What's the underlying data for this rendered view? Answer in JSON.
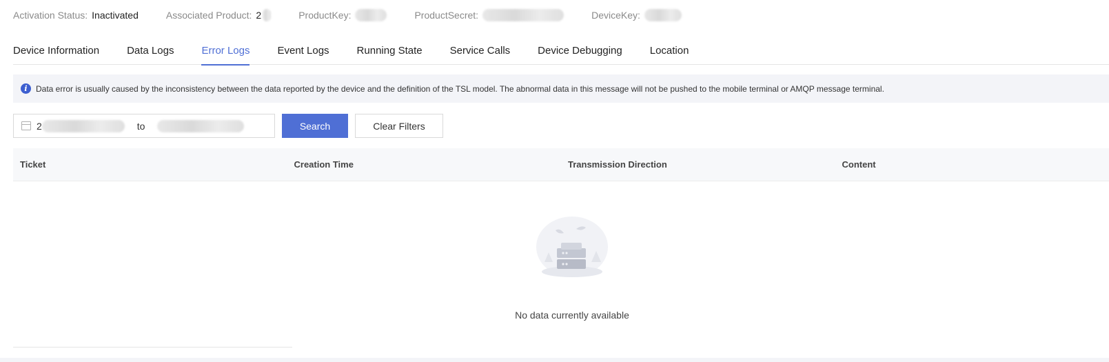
{
  "info": {
    "activation_label": "Activation Status:",
    "activation_value": "Inactivated",
    "product_label": "Associated Product:",
    "product_value": "2",
    "productkey_label": "ProductKey:",
    "productsecret_label": "ProductSecret:",
    "devicekey_label": "DeviceKey:"
  },
  "tabs": [
    {
      "label": "Device Information"
    },
    {
      "label": "Data Logs"
    },
    {
      "label": "Error Logs",
      "active": true
    },
    {
      "label": "Event Logs"
    },
    {
      "label": "Running State"
    },
    {
      "label": "Service Calls"
    },
    {
      "label": "Device Debugging"
    },
    {
      "label": "Location"
    }
  ],
  "notice": {
    "icon": "info-icon",
    "text": "Data error is usually caused by the inconsistency between the data reported by the device and the definition of the TSL model. The abnormal data in this message will not be pushed to the mobile terminal or AMQP message terminal."
  },
  "filters": {
    "date_icon": "calendar-icon",
    "date_start_prefix": "2",
    "separator": "to",
    "search_label": "Search",
    "clear_label": "Clear Filters"
  },
  "table": {
    "columns": [
      "Ticket",
      "Creation Time",
      "Transmission Direction",
      "Content"
    ],
    "empty_text": "No data currently available"
  },
  "colors": {
    "accent": "#4f6fd5",
    "notice_bg": "#f3f4f8"
  }
}
